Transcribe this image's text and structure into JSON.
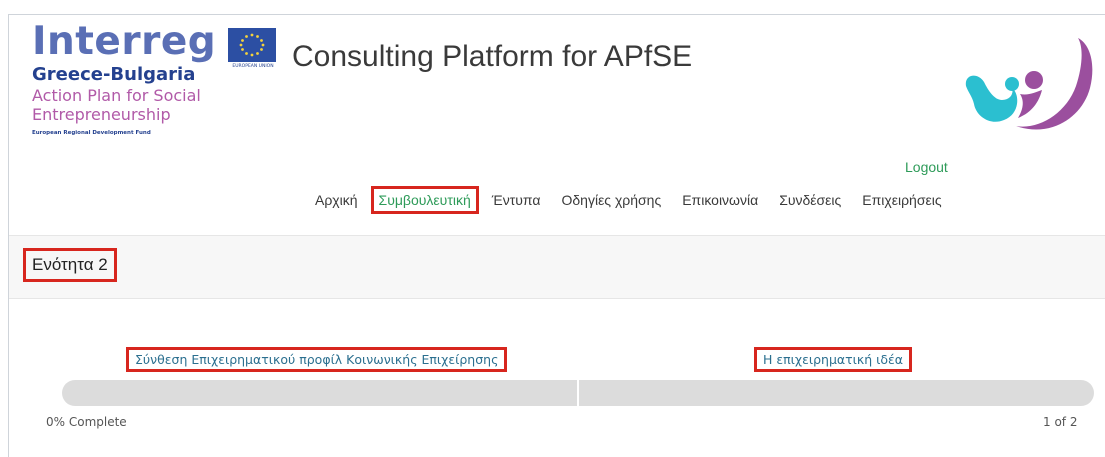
{
  "header": {
    "logo": {
      "brand": "Interreg",
      "region": "Greece-Bulgaria",
      "subtitle": "Action Plan for Social Entrepreneurship",
      "fund": "European Regional Development Fund",
      "eu_label": "EUROPEAN UNION"
    },
    "title": "Consulting Platform for APfSE",
    "brand_icon": "people-embrace-icon",
    "logout_label": "Logout"
  },
  "nav": {
    "items": [
      {
        "label": "Αρχική",
        "active": false
      },
      {
        "label": "Συμβουλευτική",
        "active": true
      },
      {
        "label": "Έντυπα",
        "active": false
      },
      {
        "label": "Οδηγίες χρήσης",
        "active": false
      },
      {
        "label": "Επικοινωνία",
        "active": false
      },
      {
        "label": "Συνδέσεις",
        "active": false
      },
      {
        "label": "Επιχειρήσεις",
        "active": false
      }
    ]
  },
  "section": {
    "title": "Ενότητα 2"
  },
  "wizard": {
    "steps": [
      {
        "label": "Σύνθεση Επιχειρηματικού προφίλ Κοινωνικής Επιχείρησης"
      },
      {
        "label": "Η επιχειρηματική ιδέα"
      }
    ],
    "progress": {
      "fraction": 0.0,
      "percent_label": "0% Complete",
      "pages_label": "1 of 2"
    }
  },
  "colors": {
    "accent_green": "#2e9b59",
    "highlight_red": "#d7261e",
    "interreg_blue": "#5a6fb5",
    "purple": "#b15aa8",
    "teal": "#2bbfd0"
  }
}
